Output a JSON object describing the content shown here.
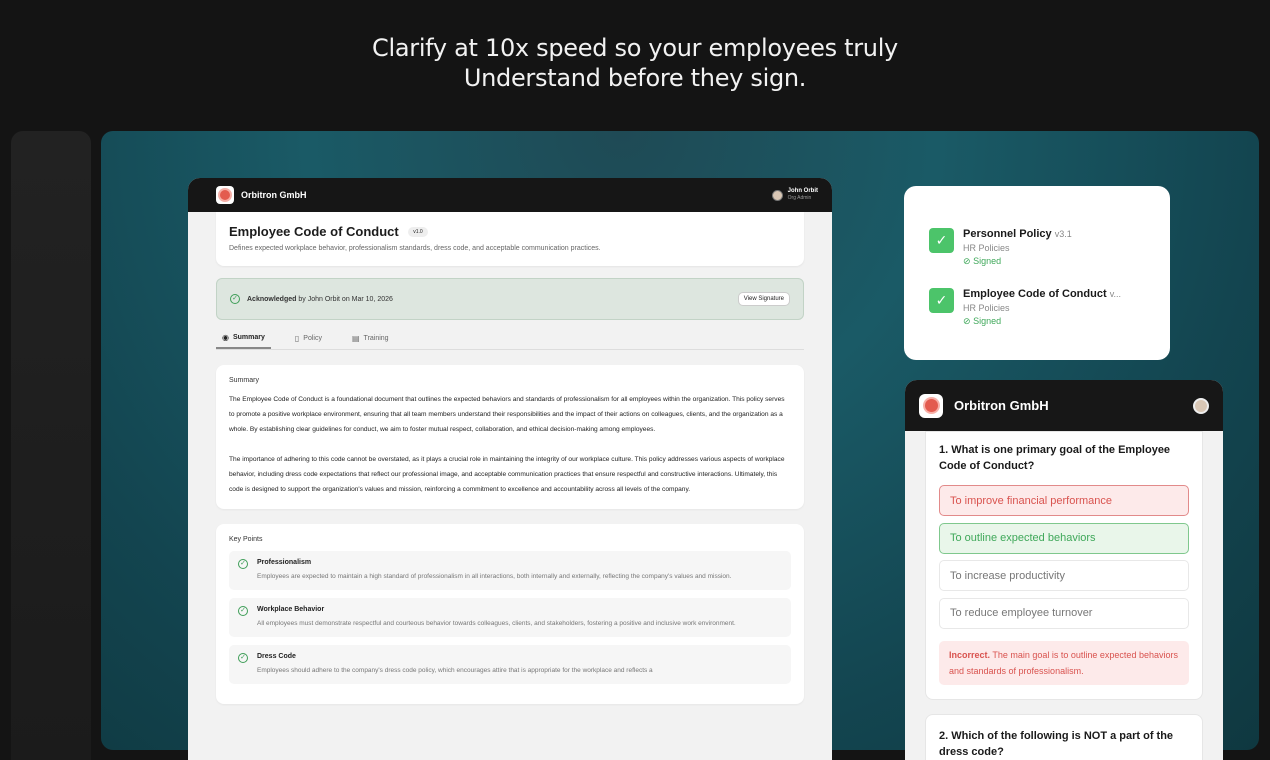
{
  "headline": {
    "line1": "Clarify at 10x speed so your employees truly",
    "line2": "Understand before they sign."
  },
  "main_window": {
    "org_name": "Orbitron GmbH",
    "user_name": "John Orbit",
    "user_role": "Org Admin",
    "doc_title": "Employee Code of Conduct",
    "doc_version": "v1.0",
    "doc_description": "Defines expected workplace behavior, professionalism standards, dress code, and acceptable communication practices.",
    "ack_label": "Acknowledged",
    "ack_detail": "by John Orbit on Mar 10, 2026",
    "view_signature": "View Signature",
    "tabs": [
      {
        "label": "Summary",
        "icon": "eye-icon"
      },
      {
        "label": "Policy",
        "icon": "document-icon"
      },
      {
        "label": "Training",
        "icon": "clipboard-icon"
      }
    ],
    "summary_title": "Summary",
    "summary_p1": "The Employee Code of Conduct is a foundational document that outlines the expected behaviors and standards of professionalism for all employees within the organization. This policy serves to promote a positive workplace environment, ensuring that all team members understand their responsibilities and the impact of their actions on colleagues, clients, and the organization as a whole. By establishing clear guidelines for conduct, we aim to foster mutual respect, collaboration, and ethical decision-making among employees.",
    "summary_p2": "The importance of adhering to this code cannot be overstated, as it plays a crucial role in maintaining the integrity of our workplace culture. This policy addresses various aspects of workplace behavior, including dress code expectations that reflect our professional image, and acceptable communication practices that ensure respectful and constructive interactions. Ultimately, this code is designed to support the organization's values and mission, reinforcing a commitment to excellence and accountability across all levels of the company.",
    "key_points_title": "Key Points",
    "key_points": [
      {
        "title": "Professionalism",
        "text": "Employees are expected to maintain a high standard of professionalism in all interactions, both internally and externally, reflecting the company's values and mission."
      },
      {
        "title": "Workplace Behavior",
        "text": "All employees must demonstrate respectful and courteous behavior towards colleagues, clients, and stakeholders, fostering a positive and inclusive work environment."
      },
      {
        "title": "Dress Code",
        "text": "Employees should adhere to the company's dress code policy, which encourages attire that is appropriate for the workplace and reflects a"
      }
    ]
  },
  "signed_card": {
    "items": [
      {
        "name": "Personnel Policy",
        "version": "v3.1",
        "category": "HR Policies",
        "status": "Signed"
      },
      {
        "name": "Employee Code of Conduct",
        "version": "v...",
        "category": "HR Policies",
        "status": "Signed"
      }
    ]
  },
  "quiz": {
    "org_name": "Orbitron GmbH",
    "q1": "1. What is one primary goal of the Employee Code of Conduct?",
    "options": [
      {
        "label": "To improve financial performance",
        "state": "wrong"
      },
      {
        "label": "To outline expected behaviors",
        "state": "right"
      },
      {
        "label": "To increase productivity",
        "state": "neutral"
      },
      {
        "label": "To reduce employee turnover",
        "state": "neutral"
      }
    ],
    "feedback_label": "Incorrect.",
    "feedback_text": "The main goal is to outline expected behaviors and standards of professionalism.",
    "q2": "2. Which of the following is NOT a part of the dress code?"
  },
  "colors": {
    "accent_green": "#4cc46a",
    "error_red": "#d9534f",
    "stage_teal": "#1a5a66"
  }
}
